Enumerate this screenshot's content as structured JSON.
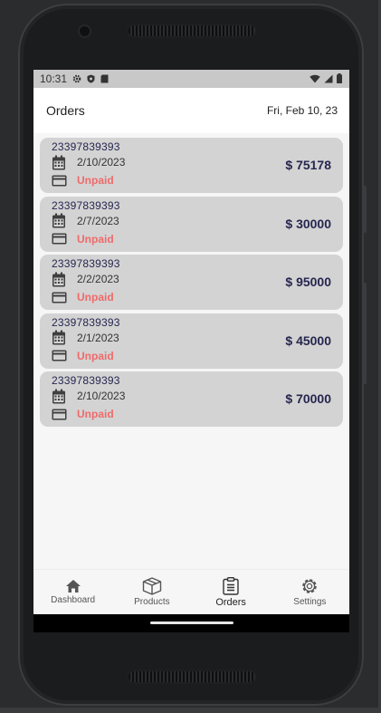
{
  "status_bar": {
    "time": "10:31",
    "left_icons": [
      "gear-icon",
      "shield-icon",
      "sd-card-icon"
    ],
    "right_icons": [
      "wifi-icon",
      "signal-icon",
      "battery-icon"
    ]
  },
  "header": {
    "title": "Orders",
    "date": "Fri, Feb 10, 23"
  },
  "orders": [
    {
      "id": "23397839393",
      "date": "2/10/2023",
      "status": "Unpaid",
      "amount": "$ 75178"
    },
    {
      "id": "23397839393",
      "date": "2/7/2023",
      "status": "Unpaid",
      "amount": "$ 30000"
    },
    {
      "id": "23397839393",
      "date": "2/2/2023",
      "status": "Unpaid",
      "amount": "$ 95000"
    },
    {
      "id": "23397839393",
      "date": "2/1/2023",
      "status": "Unpaid",
      "amount": "$ 45000"
    },
    {
      "id": "23397839393",
      "date": "2/10/2023",
      "status": "Unpaid",
      "amount": "$ 70000"
    }
  ],
  "nav": {
    "items": [
      {
        "label": "Dashboard",
        "icon": "home-icon"
      },
      {
        "label": "Products",
        "icon": "box-icon"
      },
      {
        "label": "Orders",
        "icon": "clipboard-icon",
        "active": true
      },
      {
        "label": "Settings",
        "icon": "gear-icon"
      }
    ]
  },
  "colors": {
    "card_bg": "#d3d3d3",
    "status_unpaid": "#f06a6a",
    "amount_text": "#262650"
  }
}
